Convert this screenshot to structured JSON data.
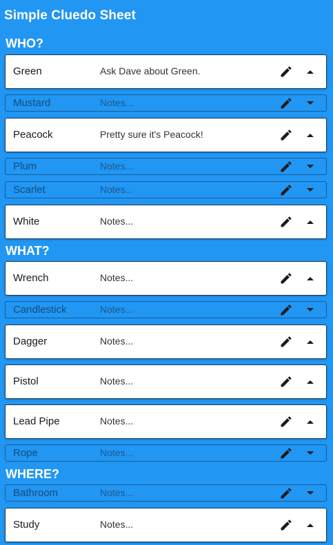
{
  "app": {
    "title": "Simple Cluedo Sheet"
  },
  "colors": {
    "background": "#2196f3",
    "card": "#ffffff",
    "text": "#212121",
    "collapsed_text": "#154c7d"
  },
  "icons": {
    "edit": "pencil-icon",
    "expanded": "caret-up-icon",
    "collapsed": "caret-down-icon"
  },
  "sections": [
    {
      "title": "WHO?",
      "items": [
        {
          "name": "Green",
          "notes": "Ask Dave about Green.",
          "state": "open"
        },
        {
          "name": "Mustard",
          "notes": "Notes...",
          "state": "collapsed"
        },
        {
          "name": "Peacock",
          "notes": "Pretty sure it's Peacock!",
          "state": "open"
        },
        {
          "name": "Plum",
          "notes": "Notes...",
          "state": "collapsed"
        },
        {
          "name": "Scarlet",
          "notes": "Notes...",
          "state": "collapsed"
        },
        {
          "name": "White",
          "notes": "Notes...",
          "state": "open"
        }
      ]
    },
    {
      "title": "WHAT?",
      "items": [
        {
          "name": "Wrench",
          "notes": "Notes...",
          "state": "open"
        },
        {
          "name": "Candlestick",
          "notes": "Notes...",
          "state": "collapsed"
        },
        {
          "name": "Dagger",
          "notes": "Notes...",
          "state": "open"
        },
        {
          "name": "Pistol",
          "notes": "Notes...",
          "state": "open"
        },
        {
          "name": "Lead Pipe",
          "notes": "Notes...",
          "state": "open"
        },
        {
          "name": "Rope",
          "notes": "Notes...",
          "state": "collapsed"
        }
      ]
    },
    {
      "title": "WHERE?",
      "items": [
        {
          "name": "Bathroom",
          "notes": "Notes...",
          "state": "collapsed"
        },
        {
          "name": "Study",
          "notes": "Notes...",
          "state": "open"
        }
      ]
    }
  ]
}
